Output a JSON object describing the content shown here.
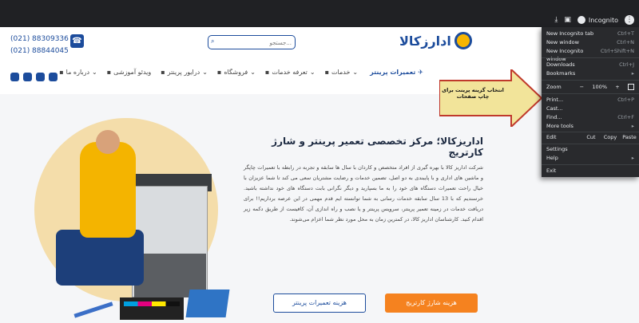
{
  "browser": {
    "mode_label": "Incognito",
    "menu": {
      "new_incognito_tab": {
        "label": "New Incognito tab",
        "shortcut": "Ctrl+T"
      },
      "new_window": {
        "label": "New window",
        "shortcut": "Ctrl+N"
      },
      "new_incognito_window": {
        "label": "New Incognito window",
        "shortcut": "Ctrl+Shift+N"
      },
      "downloads": {
        "label": "Downloads",
        "shortcut": "Ctrl+J"
      },
      "bookmarks": {
        "label": "Bookmarks"
      },
      "zoom": {
        "label": "Zoom",
        "minus": "−",
        "value": "100%",
        "plus": "+"
      },
      "print": {
        "label": "Print...",
        "shortcut": "Ctrl+P"
      },
      "cast": {
        "label": "Cast..."
      },
      "find": {
        "label": "Find...",
        "shortcut": "Ctrl+F"
      },
      "more_tools": {
        "label": "More tools"
      },
      "edit": {
        "label": "Edit",
        "cut": "Cut",
        "copy": "Copy",
        "paste": "Paste"
      },
      "settings": {
        "label": "Settings"
      },
      "help": {
        "label": "Help"
      },
      "exit": {
        "label": "Exit"
      }
    }
  },
  "header": {
    "phone_1": "(021) 88309336",
    "phone_2": "(021) 88844045",
    "search_placeholder": "جستجو...",
    "logo_text": "ادارزکالا"
  },
  "nav": {
    "items": [
      {
        "label": "تعمیرات پرینتر",
        "icon": "wrench-icon",
        "active": true
      },
      {
        "label": "خدمات",
        "icon": "briefcase-icon"
      },
      {
        "label": "تعرفه خدمات",
        "icon": "price-list-icon"
      },
      {
        "label": "فروشگاه",
        "icon": "cart-icon"
      },
      {
        "label": "درایور پرینتر",
        "icon": "windows-icon"
      },
      {
        "label": "ویدئو آموزشی",
        "icon": "video-icon"
      },
      {
        "label": "درباره ما",
        "icon": "info-icon"
      }
    ],
    "social": [
      "whatsapp-icon",
      "youtube-icon",
      "telegram-icon",
      "instagram-icon"
    ]
  },
  "hero": {
    "title": "اداریزکالا؛ مرکز تخصصی تعمیر پرینتر و شارژ کارتریج",
    "text": "شرکت اداریز کالا با بهره گیری از افراد متخصص و کاردان با سال ها سابقه و تجربه در رابطه با تعمیرات چاپگر و ماشین های اداری و با پایبندی به دو اصل، تضمین خدمات و رضایت مشتریان سعی می کند تا شما عزیزان با خیال راحت تعمیرات دستگاه های خود را به ما بسپارید و دیگر نگرانی بابت دستگاه های خود نداشته باشید. خرسندیم که با 13 سال سابقه خدمات رسانی به شما توانسته ایم قدم مهمی در این عرصه برداریم!! برای دریافت خدمات در زمینه تعمیر پرینتر، سرویس پرینتر و یا نصب و راه اندازی آن، کافیست از طریق دکمه زیر اقدام کنید. کارشناسان اداریز کالا، در کمترین زمان به محل مورد نظر شما اعزام می‌شوند.",
    "btn_cartridge": "هزینه شارژ کارتریج",
    "btn_printer": "هزینه تعمیرات پرینتر"
  },
  "annotation": {
    "label": "انتخاب گزینه پرینت برای چاپ صفحات"
  },
  "colors": {
    "brand": "#1c4c9c",
    "accent": "#f5821f",
    "chrome_bg": "#202124",
    "menu_bg": "#292a2d"
  }
}
